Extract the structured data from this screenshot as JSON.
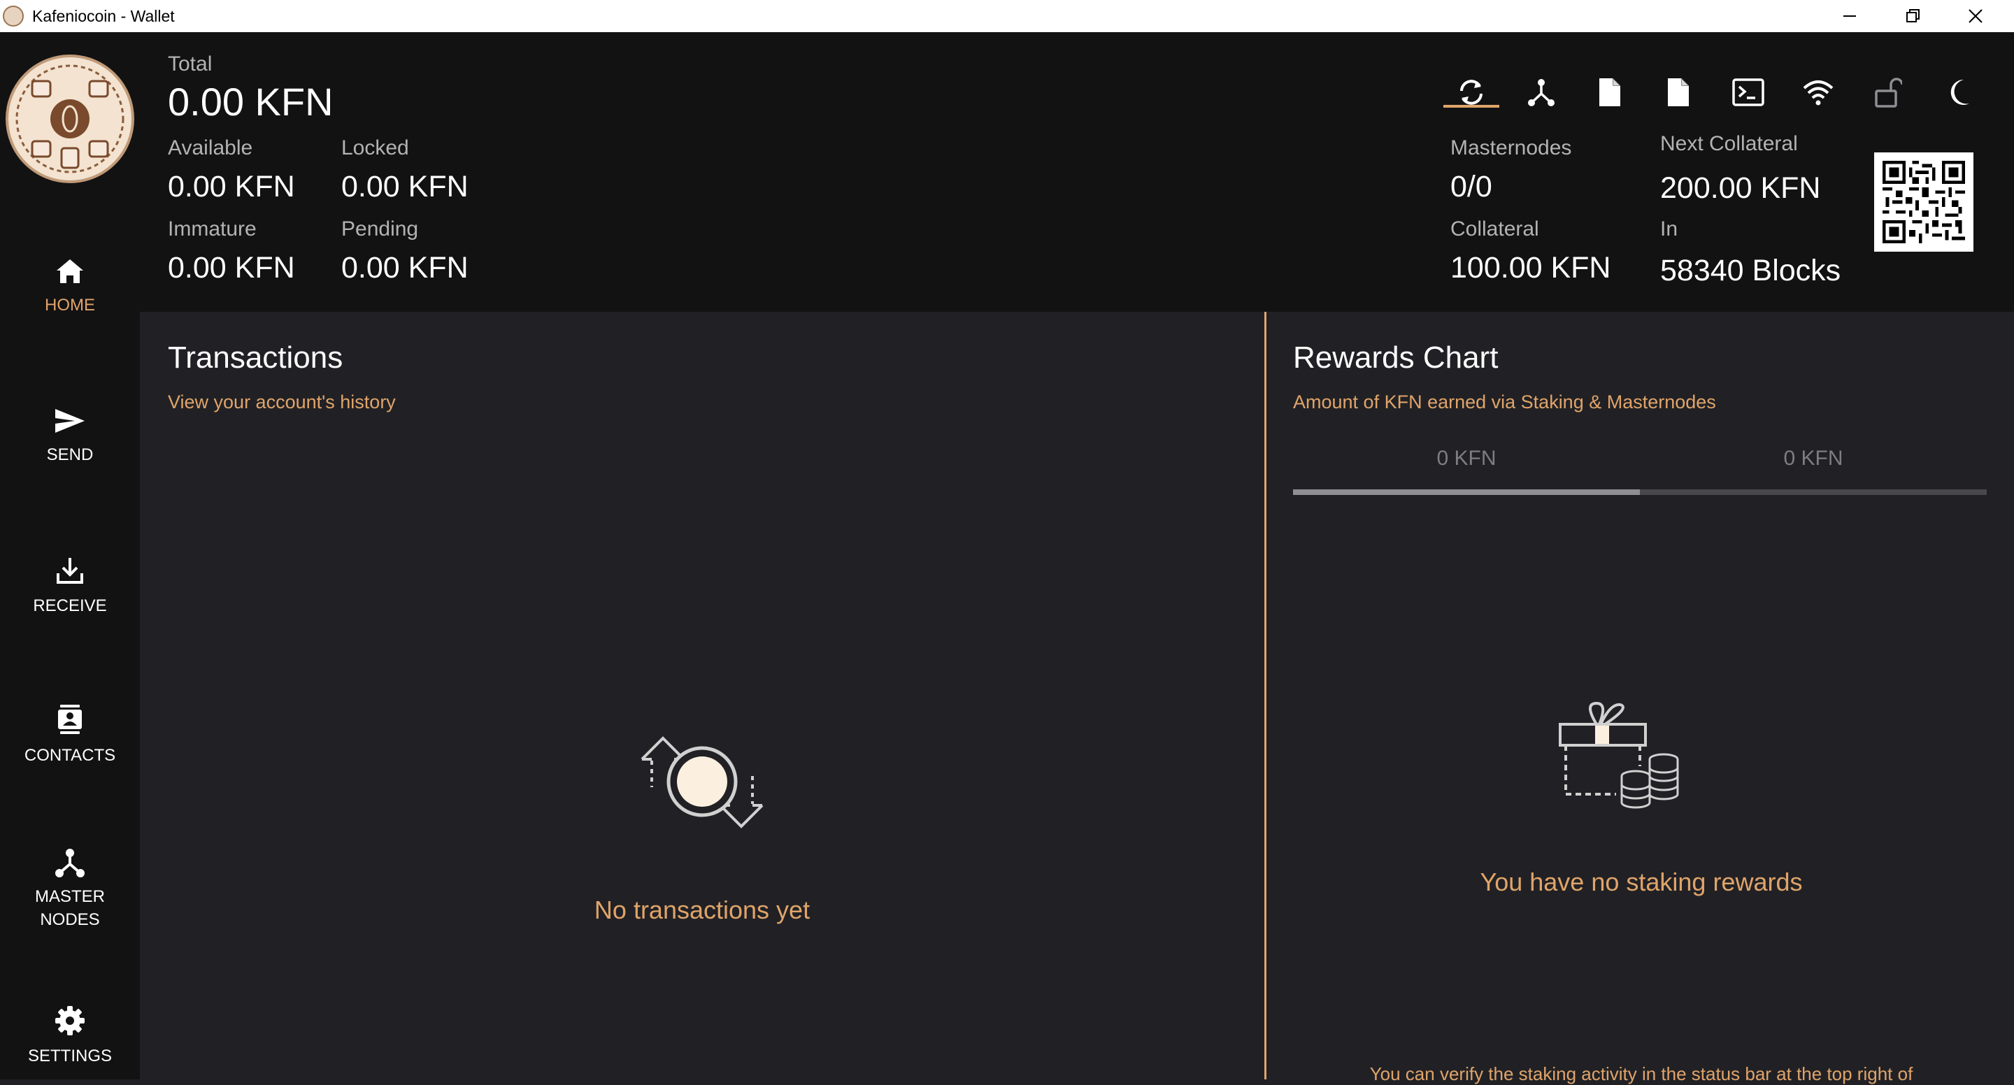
{
  "window": {
    "title": "Kafeniocoin - Wallet"
  },
  "sidebar": {
    "items": [
      {
        "label": "HOME",
        "icon": "home-icon",
        "active": true
      },
      {
        "label": "SEND",
        "icon": "send-icon"
      },
      {
        "label": "RECEIVE",
        "icon": "receive-icon"
      },
      {
        "label": "CONTACTS",
        "icon": "contacts-icon"
      },
      {
        "label_line1": "MASTER",
        "label_line2": "NODES",
        "icon": "masternodes-icon"
      },
      {
        "label": "SETTINGS",
        "icon": "gear-icon"
      }
    ]
  },
  "balances": {
    "total_label": "Total",
    "total_value": "0.00 KFN",
    "available_label": "Available",
    "available_value": "0.00 KFN",
    "locked_label": "Locked",
    "locked_value": "0.00 KFN",
    "immature_label": "Immature",
    "immature_value": "0.00 KFN",
    "pending_label": "Pending",
    "pending_value": "0.00 KFN"
  },
  "masternode_info": {
    "masternodes_label": "Masternodes",
    "masternodes_value": "0/0",
    "collateral_label": "Collateral",
    "collateral_value": "100.00 KFN",
    "next_collateral_label": "Next Collateral",
    "next_collateral_value": "200.00 KFN",
    "in_label": "In",
    "in_value": "58340 Blocks"
  },
  "toolbar": {
    "icons": [
      "sync-icon",
      "network-icon",
      "document-icon",
      "document-icon",
      "console-icon",
      "wifi-icon",
      "unlock-icon",
      "moon-icon"
    ]
  },
  "transactions": {
    "title": "Transactions",
    "subtitle": "View your account's history",
    "empty_text": "No transactions yet"
  },
  "rewards": {
    "title": "Rewards Chart",
    "subtitle": "Amount of KFN earned via Staking & Masternodes",
    "tab_left": "0 KFN",
    "tab_right": "0 KFN",
    "empty_text": "You have no staking rewards",
    "footer_note": "You can verify the staking activity in the status bar at the top right of"
  },
  "colors": {
    "accent": "#e0a46a",
    "sidebar_bg": "#121213",
    "panel_bg": "#212125"
  }
}
